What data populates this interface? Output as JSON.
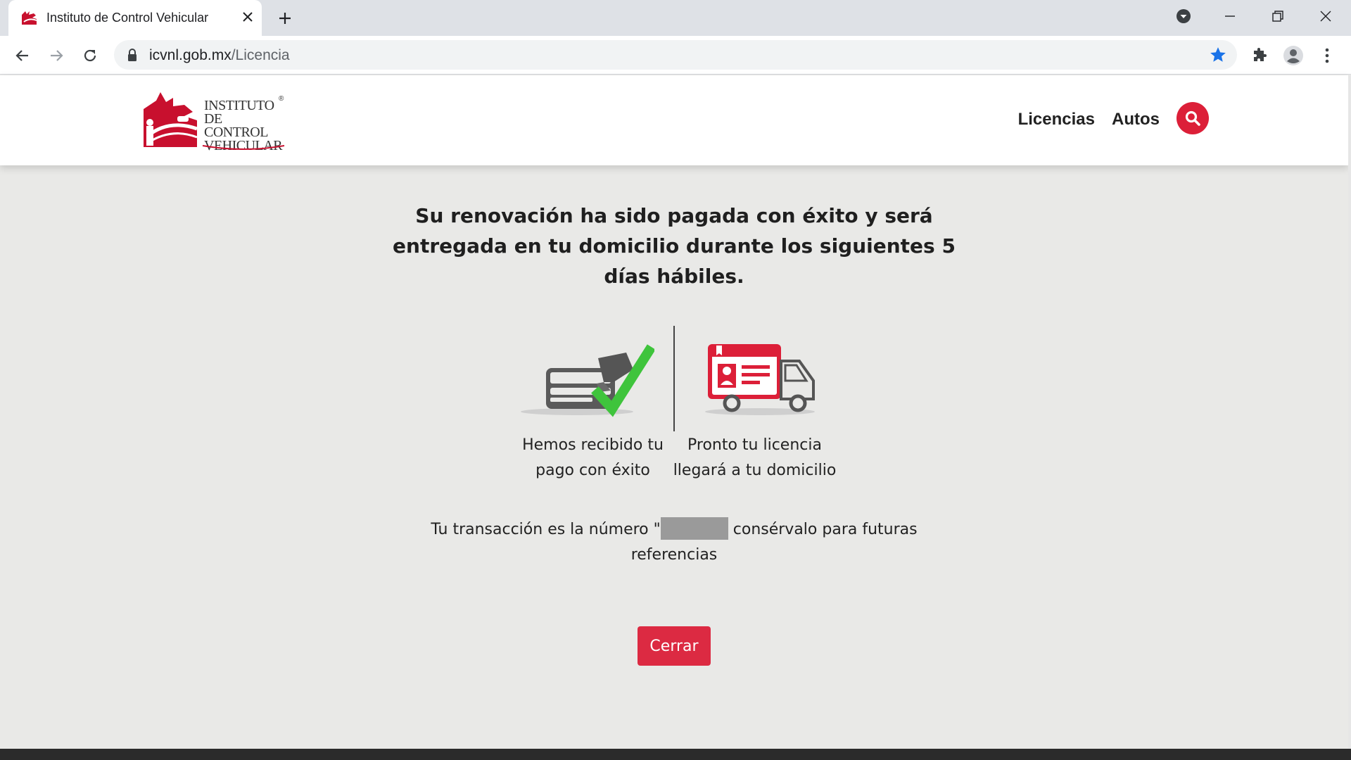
{
  "browser": {
    "tab_title": "Instituto de Control Vehicular",
    "url_host": "icvnl.gob.mx",
    "url_path": "/Licencia"
  },
  "site": {
    "logo_lines": [
      "INSTITUTO",
      "DE CONTROL",
      "VEHICULAR"
    ],
    "logo_reg": "®",
    "nav": {
      "licencias": "Licencias",
      "autos": "Autos"
    }
  },
  "content": {
    "heading": "Su renovación ha sido pagada con éxito y será entregada en tu domicilio durante los siguientes 5 días hábiles.",
    "caption_payment": "Hemos recibido tu pago con éxito",
    "caption_delivery": "Pronto tu licencia llegará a tu domicilio",
    "transaction_prefix": "Tu transacción es la número \"",
    "transaction_suffix": " consérvalo para futuras referencias",
    "close_label": "Cerrar"
  },
  "colors": {
    "brand_red": "#dc1f38",
    "check_green": "#3fc43c",
    "page_bg": "#e9e9e7"
  }
}
